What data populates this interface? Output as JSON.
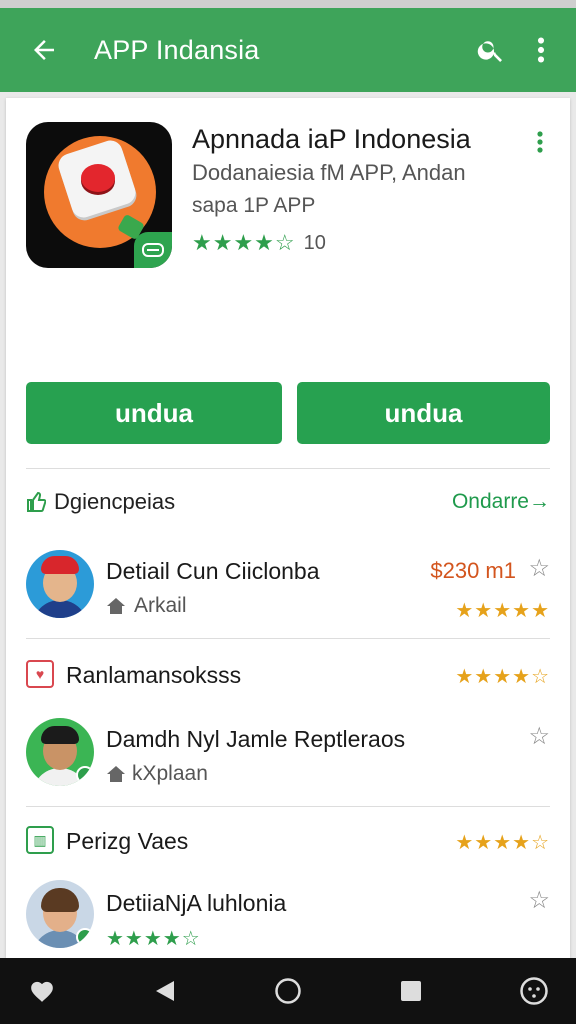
{
  "appbar": {
    "title": "APP Indansia",
    "icons": [
      "back-arrow-icon",
      "search-icon",
      "more-vert-icon"
    ]
  },
  "app": {
    "title": "Apnnada iaP Indonesia",
    "subtitle1": "Dodanaiesia fM APP, Andan",
    "subtitle2": "sapa 1P APP",
    "rating_count": "10",
    "stars": "★★★★☆",
    "rating": 3.5
  },
  "buttons": {
    "primary": "undua",
    "secondary": "undua"
  },
  "section": {
    "label": "Dgiencpeias",
    "link": "Ondarre→"
  },
  "items": [
    {
      "name": "Detiail Cun Ciiclonba",
      "meta": "Arkail",
      "price": "$230 m1",
      "stars": "★★★★★",
      "rating": 4.5
    },
    {
      "name": "Damdh Nyl Jamle Reptleraos",
      "meta": "kXplaan",
      "stars": "",
      "rating": null
    },
    {
      "name": "DetiiaNjA luhlonia",
      "stars": "★★★★☆",
      "rating": 4.5
    }
  ],
  "subsections": [
    {
      "label": "Ranlamansoksss",
      "stars": "★★★★☆",
      "rating": 4.0
    },
    {
      "label": "Perizg Vaes",
      "stars": "★★★★☆",
      "rating": 4.0
    }
  ],
  "colors": {
    "brand": "#3ea45a",
    "button": "#27a150",
    "price": "#d3551e",
    "star_gold": "#e6a21b",
    "star_green": "#2e9e4c"
  }
}
